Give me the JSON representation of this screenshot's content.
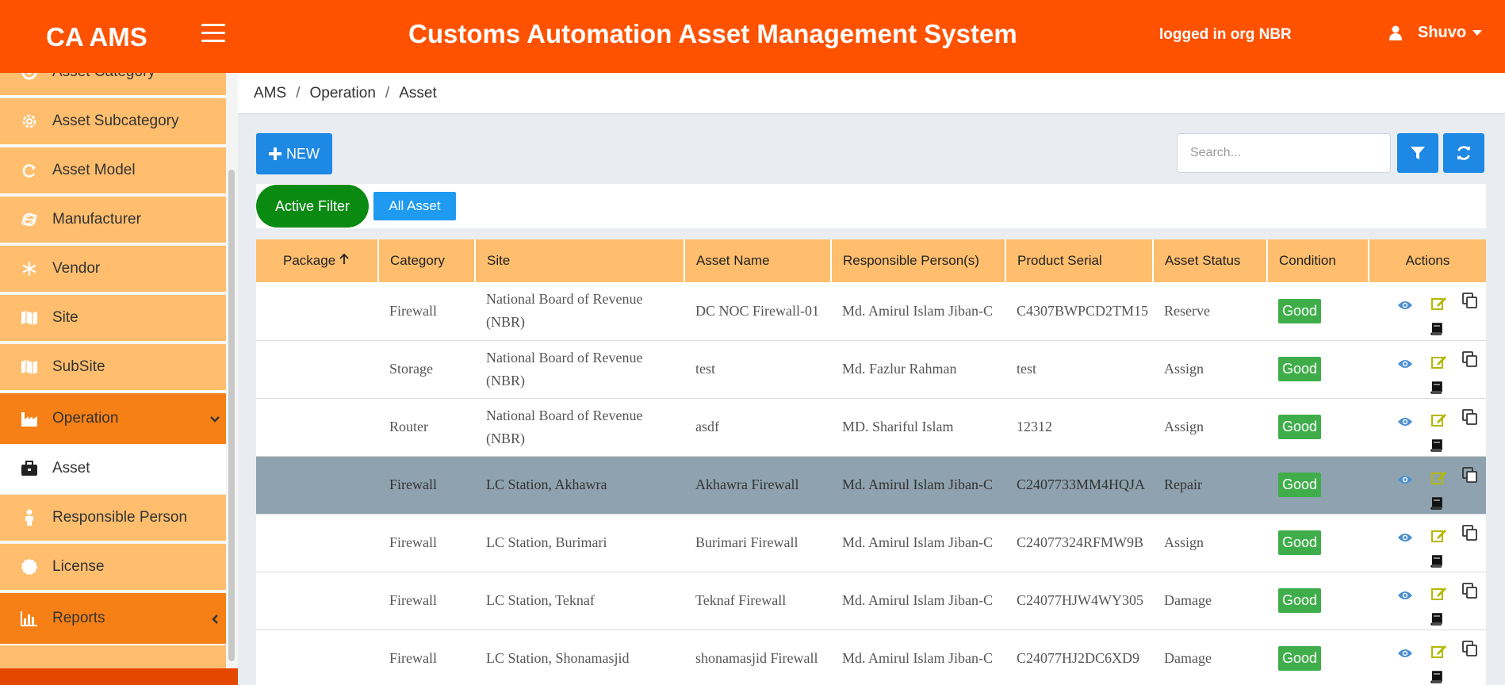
{
  "header": {
    "brand": "CA AMS",
    "title": "Customs Automation Asset Management System",
    "org_text": "logged in org NBR",
    "user_name": "Shuvo"
  },
  "sidebar": {
    "items": [
      {
        "label": "Asset Category",
        "icon": "settings-icon"
      },
      {
        "label": "Asset Subcategory",
        "icon": "gear-icon"
      },
      {
        "label": "Asset Model",
        "icon": "refresh-icon"
      },
      {
        "label": "Manufacturer",
        "icon": "ie-icon"
      },
      {
        "label": "Vendor",
        "icon": "snowflake-icon"
      },
      {
        "label": "Site",
        "icon": "map-icon"
      },
      {
        "label": "SubSite",
        "icon": "map-icon"
      },
      {
        "label": "Operation",
        "icon": "industry-icon"
      },
      {
        "label": "Asset",
        "icon": "briefcase-icon"
      },
      {
        "label": "Responsible Person",
        "icon": "person-icon"
      },
      {
        "label": "License",
        "icon": "certificate-icon"
      },
      {
        "label": "Reports",
        "icon": "bar-chart-icon"
      }
    ]
  },
  "breadcrumb": [
    "AMS",
    "Operation",
    "Asset"
  ],
  "toolbar": {
    "new_label": "NEW",
    "search_placeholder": "Search..."
  },
  "filters": {
    "active_label": "Active Filter",
    "all_label": "All Asset"
  },
  "table": {
    "columns": [
      "Package",
      "Category",
      "Site",
      "Asset Name",
      "Responsible Person(s)",
      "Product Serial",
      "Asset Status",
      "Condition",
      "Actions"
    ],
    "rows": [
      {
        "package": "",
        "category": "Firewall",
        "site": "National Board of Revenue (NBR)",
        "asset_name": "DC NOC Firewall-01",
        "person": "Md. Amirul Islam Jiban-C",
        "serial": "C4307BWPCD2TM15",
        "status": "Reserve",
        "condition": "Good"
      },
      {
        "package": "",
        "category": "Storage",
        "site": "National Board of Revenue (NBR)",
        "asset_name": "test",
        "person": "Md. Fazlur Rahman",
        "serial": "test",
        "status": "Assign",
        "condition": "Good"
      },
      {
        "package": "",
        "category": "Router",
        "site": "National Board of Revenue (NBR)",
        "asset_name": "asdf",
        "person": "MD. Shariful Islam",
        "serial": "12312",
        "status": "Assign",
        "condition": "Good"
      },
      {
        "package": "",
        "category": "Firewall",
        "site": "LC Station, Akhawra",
        "asset_name": "Akhawra Firewall",
        "person": "Md. Amirul Islam Jiban-C",
        "serial": "C2407733MM4HQJA",
        "status": "Repair",
        "condition": "Good"
      },
      {
        "package": "",
        "category": "Firewall",
        "site": "LC Station, Burimari",
        "asset_name": "Burimari Firewall",
        "person": "Md. Amirul Islam Jiban-C",
        "serial": "C24077324RFMW9B",
        "status": "Assign",
        "condition": "Good"
      },
      {
        "package": "",
        "category": "Firewall",
        "site": "LC Station, Teknaf",
        "asset_name": "Teknaf Firewall",
        "person": "Md. Amirul Islam Jiban-C",
        "serial": "C24077HJW4WY305",
        "status": "Damage",
        "condition": "Good"
      },
      {
        "package": "",
        "category": "Firewall",
        "site": "LC Station, Shonamasjid",
        "asset_name": "shonamasjid Firewall",
        "person": "Md. Amirul Islam Jiban-C",
        "serial": "C24077HJ2DC6XD9",
        "status": "Damage",
        "condition": "Good"
      }
    ],
    "selected_row": 3
  },
  "colors": {
    "header": "#ff5200",
    "sidebar_item": "#ffbe6e",
    "sidebar_active": "#f78016",
    "primary": "#1e88e5",
    "active_filter": "#0b8a12",
    "good_badge": "#3fae4a",
    "selected_row": "#8ea3af"
  }
}
